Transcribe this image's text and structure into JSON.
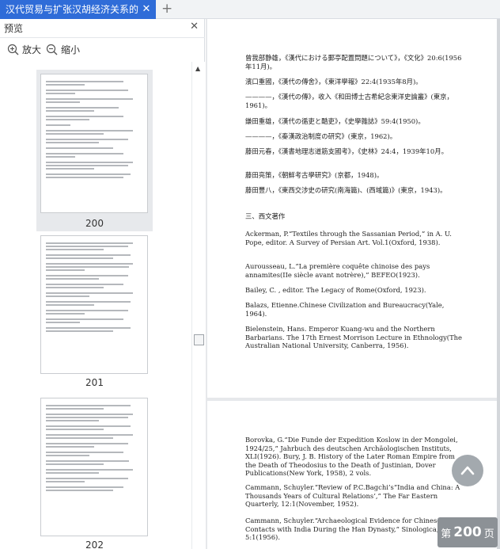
{
  "tab": {
    "title": "汉代贸易与扩张汉胡经济关系的"
  },
  "sidebar": {
    "title": "预览",
    "zoom_in_label": "放大",
    "zoom_out_label": "缩小",
    "thumbnails": [
      {
        "label": "200",
        "selected": true
      },
      {
        "label": "201",
        "selected": false
      },
      {
        "label": "202",
        "selected": false
      }
    ]
  },
  "page1": {
    "entries": [
      "曾我部静雄，《漢代における郵亭配置問題について》，《文化》20:6(1956年11月)。",
      "濱口重國，《漢代の傳舍》，《東洋學報》22:4(1935年8月)。",
      "————，《漢代の傳》，收入《和田博士古希紀念東洋史論叢》(東京，1961)。",
      "鎌田重雄，《漢代の循吏と酷吏》，《史學雜誌》59:4(1950)。",
      "————，《秦漢政治制度の研究》(東京，1962)。",
      "藤田元春，《漢書地理志道筋支國考》，《史林》24:4，1939年10月。",
      "藤田亮策，《朝鮮考古學研究》(京都，1948)。",
      "藤田豐八，《東西交涉史の研究(南海篇)、(西域篇)》(東京，1943)。"
    ],
    "section_heading": "三、西文著作",
    "western_entries": [
      "Ackerman, P.“Textiles through the Sassanian Period,” in A. U. Pope, editor. A Survey of Persian Art. Vol.1(Oxford, 1938).",
      "Aurousseau, L.“La première coquête chinoise des pays annamites(IIe siècle avant notrère),” BEFEO(1923).",
      "Bailey, C. , editor. The Legacy of Rome(Oxford, 1923).",
      "Balazs, Etienne.Chinese Civilization and Bureaucracy(Yale, 1964).",
      "Bielenstein, Hans. Emperor Kuang-wu and the Northern Barbarians. The 17th Ernest Morrison Lecture in Ethnology(The Australian National University, Canberra, 1956)."
    ]
  },
  "page2": {
    "entries": [
      "Borovka, G.“Die Funde der Expedition Koslow in der Mongolei, 1924/25,” Jahrbuch des deutschen Archäologischen Instituts, XLI(1926). Bury, J. B. History of the Later Roman Empire from the Death of Theodosius to the Death of Justinian, Dover Publications(New York, 1958), 2 vols.",
      "Cammann, Schuyler.“Review of P.C.Bagchi’s“India and China: A Thousands Years of Cultural Relations’,” The Far Eastern Quarterly, 12:1(November, 1952).",
      "Cammann, Schuyler.“Archaeological Evidence for Chinese Contacts with India During the Han Dynasty,” Sinologica, 5:1(1956)."
    ]
  },
  "page_indicator": {
    "prefix": "第",
    "number": "200",
    "suffix": "页"
  },
  "icons": {
    "tab_close": "close-icon",
    "new_tab": "plus-icon",
    "zoom_in": "zoom-in-icon",
    "zoom_out": "zoom-out-icon",
    "back_to_top": "arrow-up-icon"
  },
  "colors": {
    "tab_active": "#2f6cd8",
    "page_indicator_bg": "#8c9196"
  }
}
